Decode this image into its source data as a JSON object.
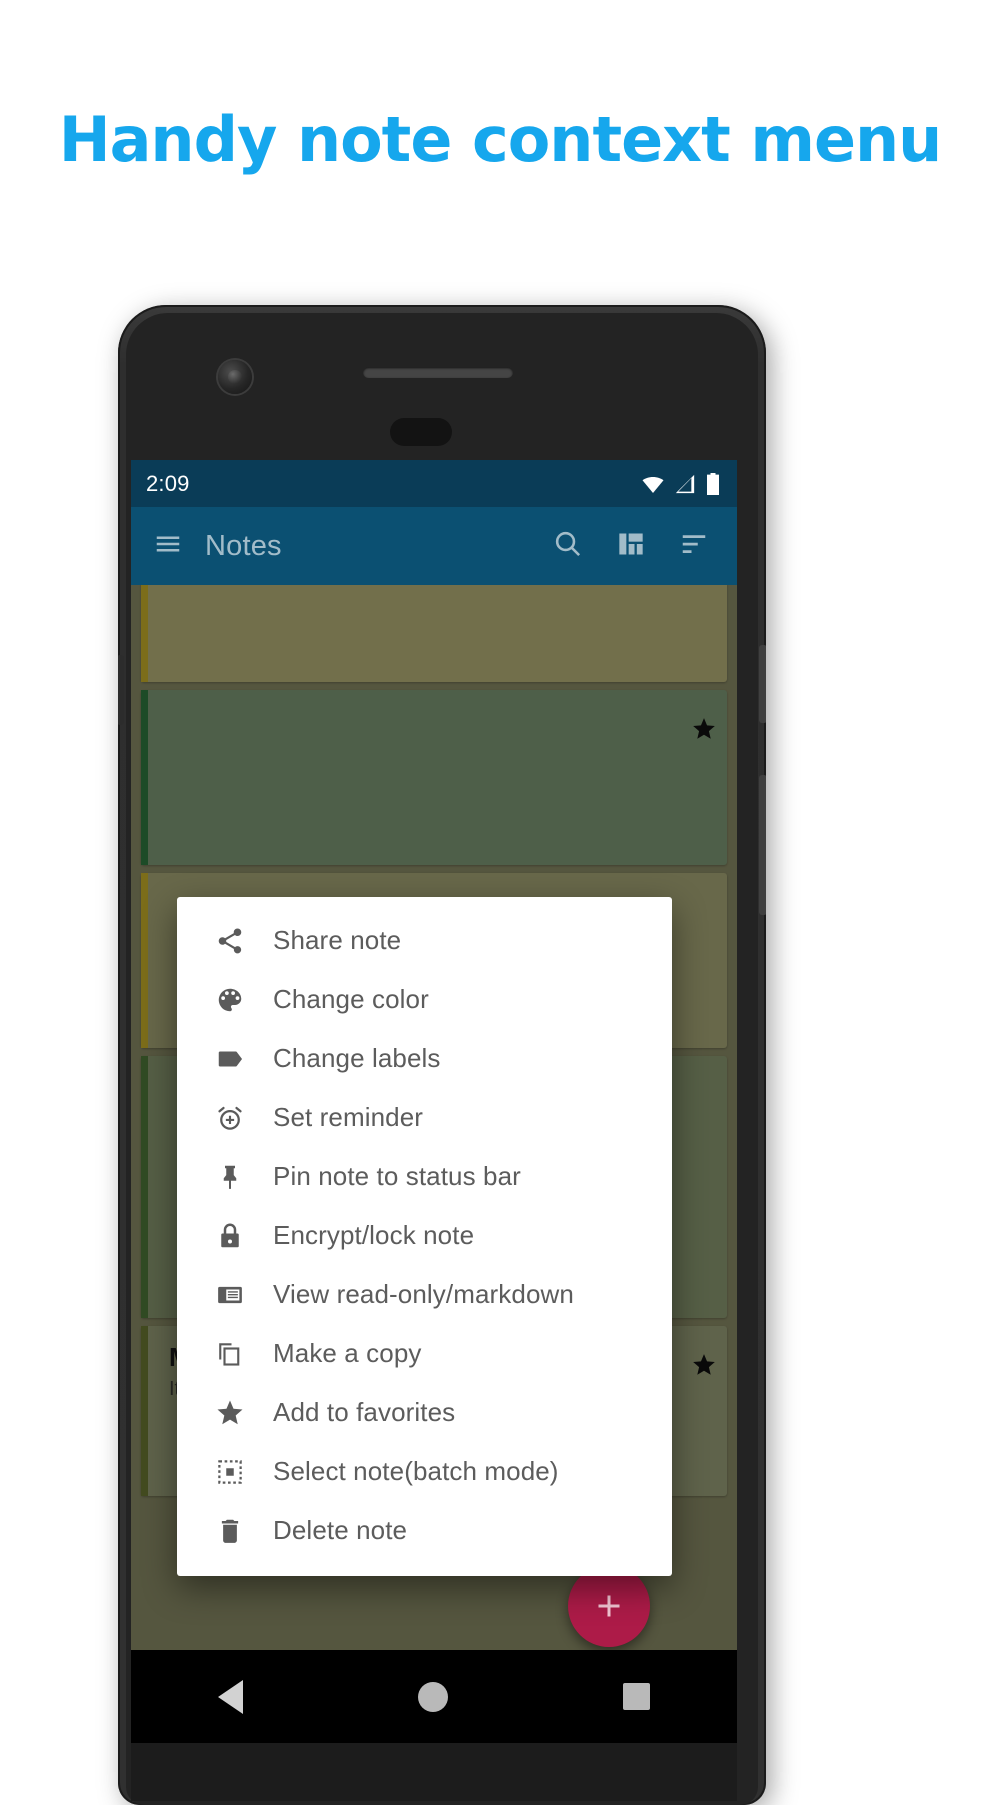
{
  "headline": "Handy note context menu",
  "colors": {
    "headline": "#16a7ed",
    "statusbar": "#0a3c57",
    "appbar": "#0b5072",
    "fab": "#ad1b48",
    "menu_bg": "#ffffff",
    "menu_text": "#5c5c5c"
  },
  "phone": {
    "statusbar": {
      "time": "2:09",
      "icons": [
        "wifi-icon",
        "signal-icon",
        "battery-icon"
      ]
    },
    "appbar": {
      "menu_icon": "hamburger-menu-icon",
      "title": "Notes",
      "actions": [
        {
          "name": "search-icon",
          "label": "Search"
        },
        {
          "name": "layout-grid-icon",
          "label": "Change layout"
        },
        {
          "name": "sort-icon",
          "label": "Sort"
        }
      ]
    },
    "navbar": {
      "back": "back-triangle-icon",
      "home": "home-circle-icon",
      "recents": "recents-square-icon"
    }
  },
  "context_menu": {
    "items": [
      {
        "icon": "share-icon",
        "label": "Share note"
      },
      {
        "icon": "palette-icon",
        "label": "Change color"
      },
      {
        "icon": "label-tag-icon",
        "label": "Change labels"
      },
      {
        "icon": "alarm-add-icon",
        "label": "Set reminder"
      },
      {
        "icon": "pushpin-icon",
        "label": "Pin note to status bar"
      },
      {
        "icon": "lock-icon",
        "label": "Encrypt/lock note"
      },
      {
        "icon": "article-icon",
        "label": "View read-only/markdown"
      },
      {
        "icon": "copy-icon",
        "label": "Make a copy"
      },
      {
        "icon": "star-icon",
        "label": "Add to favorites"
      },
      {
        "icon": "select-dashed-icon",
        "label": "Select note(batch mode)"
      },
      {
        "icon": "trash-icon",
        "label": "Delete note"
      }
    ]
  },
  "notes": [
    {
      "title": "",
      "body": "",
      "stripe": "#c9b02a",
      "bg": "#b9b37a",
      "star": false
    },
    {
      "title": "",
      "body": "",
      "stripe": "#2f7a3f",
      "bg": "#7e9a77",
      "star": true
    },
    {
      "title": "",
      "body": "",
      "stripe": "#c9b02a",
      "bg": "#a9a878",
      "star": false
    },
    {
      "title": "",
      "body": "",
      "stripe": "#4f7a3a",
      "bg": "#8b9a72",
      "star": false
    },
    {
      "title": "My supersecret journal",
      "body": "It's very top secret...",
      "stripe": "#6d7a35",
      "bg": "#9aa07a",
      "star": true
    }
  ],
  "fab": {
    "label": "+",
    "name": "add-note-fab"
  }
}
